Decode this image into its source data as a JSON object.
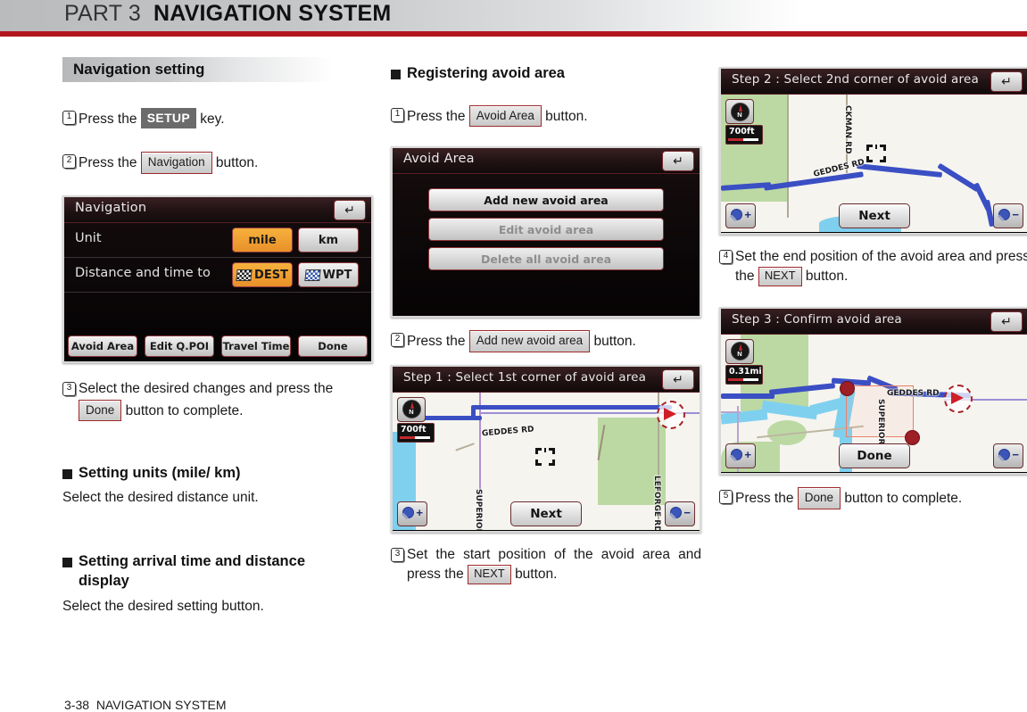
{
  "header": {
    "part": "PART 3",
    "title": "NAVIGATION SYSTEM"
  },
  "footer": {
    "page": "3-38",
    "section": "NAVIGATION SYSTEM"
  },
  "left_column": {
    "banner": "Navigation setting",
    "step1": {
      "num": "1",
      "pre": "Press the",
      "key": "SETUP",
      "post": "key."
    },
    "step2": {
      "num": "2",
      "pre": "Press the",
      "key": "Navigation",
      "post": "button."
    },
    "nav_device": {
      "title": "Navigation",
      "back_icon": "back-arrow-icon",
      "rows": [
        {
          "label": "Unit",
          "options": [
            {
              "text": "mile",
              "selected": true
            },
            {
              "text": "km",
              "selected": false
            }
          ]
        },
        {
          "label": "Distance and time to",
          "options": [
            {
              "text": "DEST",
              "selected": true,
              "icon": "checkered-flag-icon"
            },
            {
              "text": "WPT",
              "selected": false,
              "icon": "checkered-flag-blue-icon"
            }
          ]
        }
      ],
      "bottom_buttons": [
        "Avoid Area",
        "Edit Q.POI",
        "Travel Time",
        "Done"
      ]
    },
    "step3": {
      "num": "3",
      "pre": "Select the desired changes and press the",
      "key": "Done",
      "post": "button to complete."
    },
    "heading_units": "Setting units (mile/ km)",
    "text_units": "Select the desired distance unit.",
    "heading_arrival": "Setting arrival time and distance display",
    "text_arrival": "Select the desired setting button."
  },
  "middle_column": {
    "heading": "Registering avoid area",
    "step1": {
      "num": "1",
      "pre": "Press the",
      "key": "Avoid Area",
      "post": "button."
    },
    "avoid_device": {
      "title": "Avoid Area",
      "back_icon": "back-arrow-icon",
      "buttons": [
        {
          "label": "Add new avoid area",
          "enabled": true
        },
        {
          "label": "Edit avoid area",
          "enabled": false
        },
        {
          "label": "Delete all avoid area",
          "enabled": false
        }
      ]
    },
    "step2": {
      "num": "2",
      "pre": "Press the",
      "key": "Add new avoid area",
      "post": "button."
    },
    "map_device": {
      "title": "Step 1 : Select 1st corner of avoid area",
      "back_icon": "back-arrow-icon",
      "scale": "700ft",
      "compass": "N",
      "next_label": "Next",
      "zoom_in": "zoom-in-icon",
      "zoom_out": "zoom-out-icon",
      "road_labels": [
        "GEDDES RD",
        "SUPERIOR RD",
        "LEFORGE RD"
      ]
    },
    "step3": {
      "num": "3",
      "pre": "Set the start position of the avoid area and press the",
      "key": "NEXT",
      "post": "button."
    }
  },
  "right_column": {
    "map_device_2": {
      "title": "Step 2 : Select 2nd corner of avoid area",
      "back_icon": "back-arrow-icon",
      "scale": "700ft",
      "compass": "N",
      "next_label": "Next",
      "zoom_in": "zoom-in-icon",
      "zoom_out": "zoom-out-icon",
      "road_labels": [
        "CKMAN RD",
        "GEDDES RD"
      ]
    },
    "step4": {
      "num": "4",
      "pre": "Set the end position of the avoid area and press the",
      "key": "NEXT",
      "post": "button."
    },
    "map_device_3": {
      "title": "Step 3 : Confirm avoid area",
      "back_icon": "back-arrow-icon",
      "scale": "0.31mi",
      "compass": "N",
      "done_label": "Done",
      "zoom_in": "zoom-in-icon",
      "zoom_out": "zoom-out-icon",
      "road_labels": [
        "GEDDES RD",
        "SUPERIOR RD"
      ]
    },
    "step5": {
      "num": "5",
      "pre": "Press the",
      "key": "Done",
      "post": "button to complete."
    }
  },
  "colors": {
    "accent_red": "#b3151f",
    "highlight_orange": "#e8902a",
    "route_blue": "#3b4fc4",
    "park_green": "#bcd9a3",
    "water_blue": "#7fd0ef"
  }
}
